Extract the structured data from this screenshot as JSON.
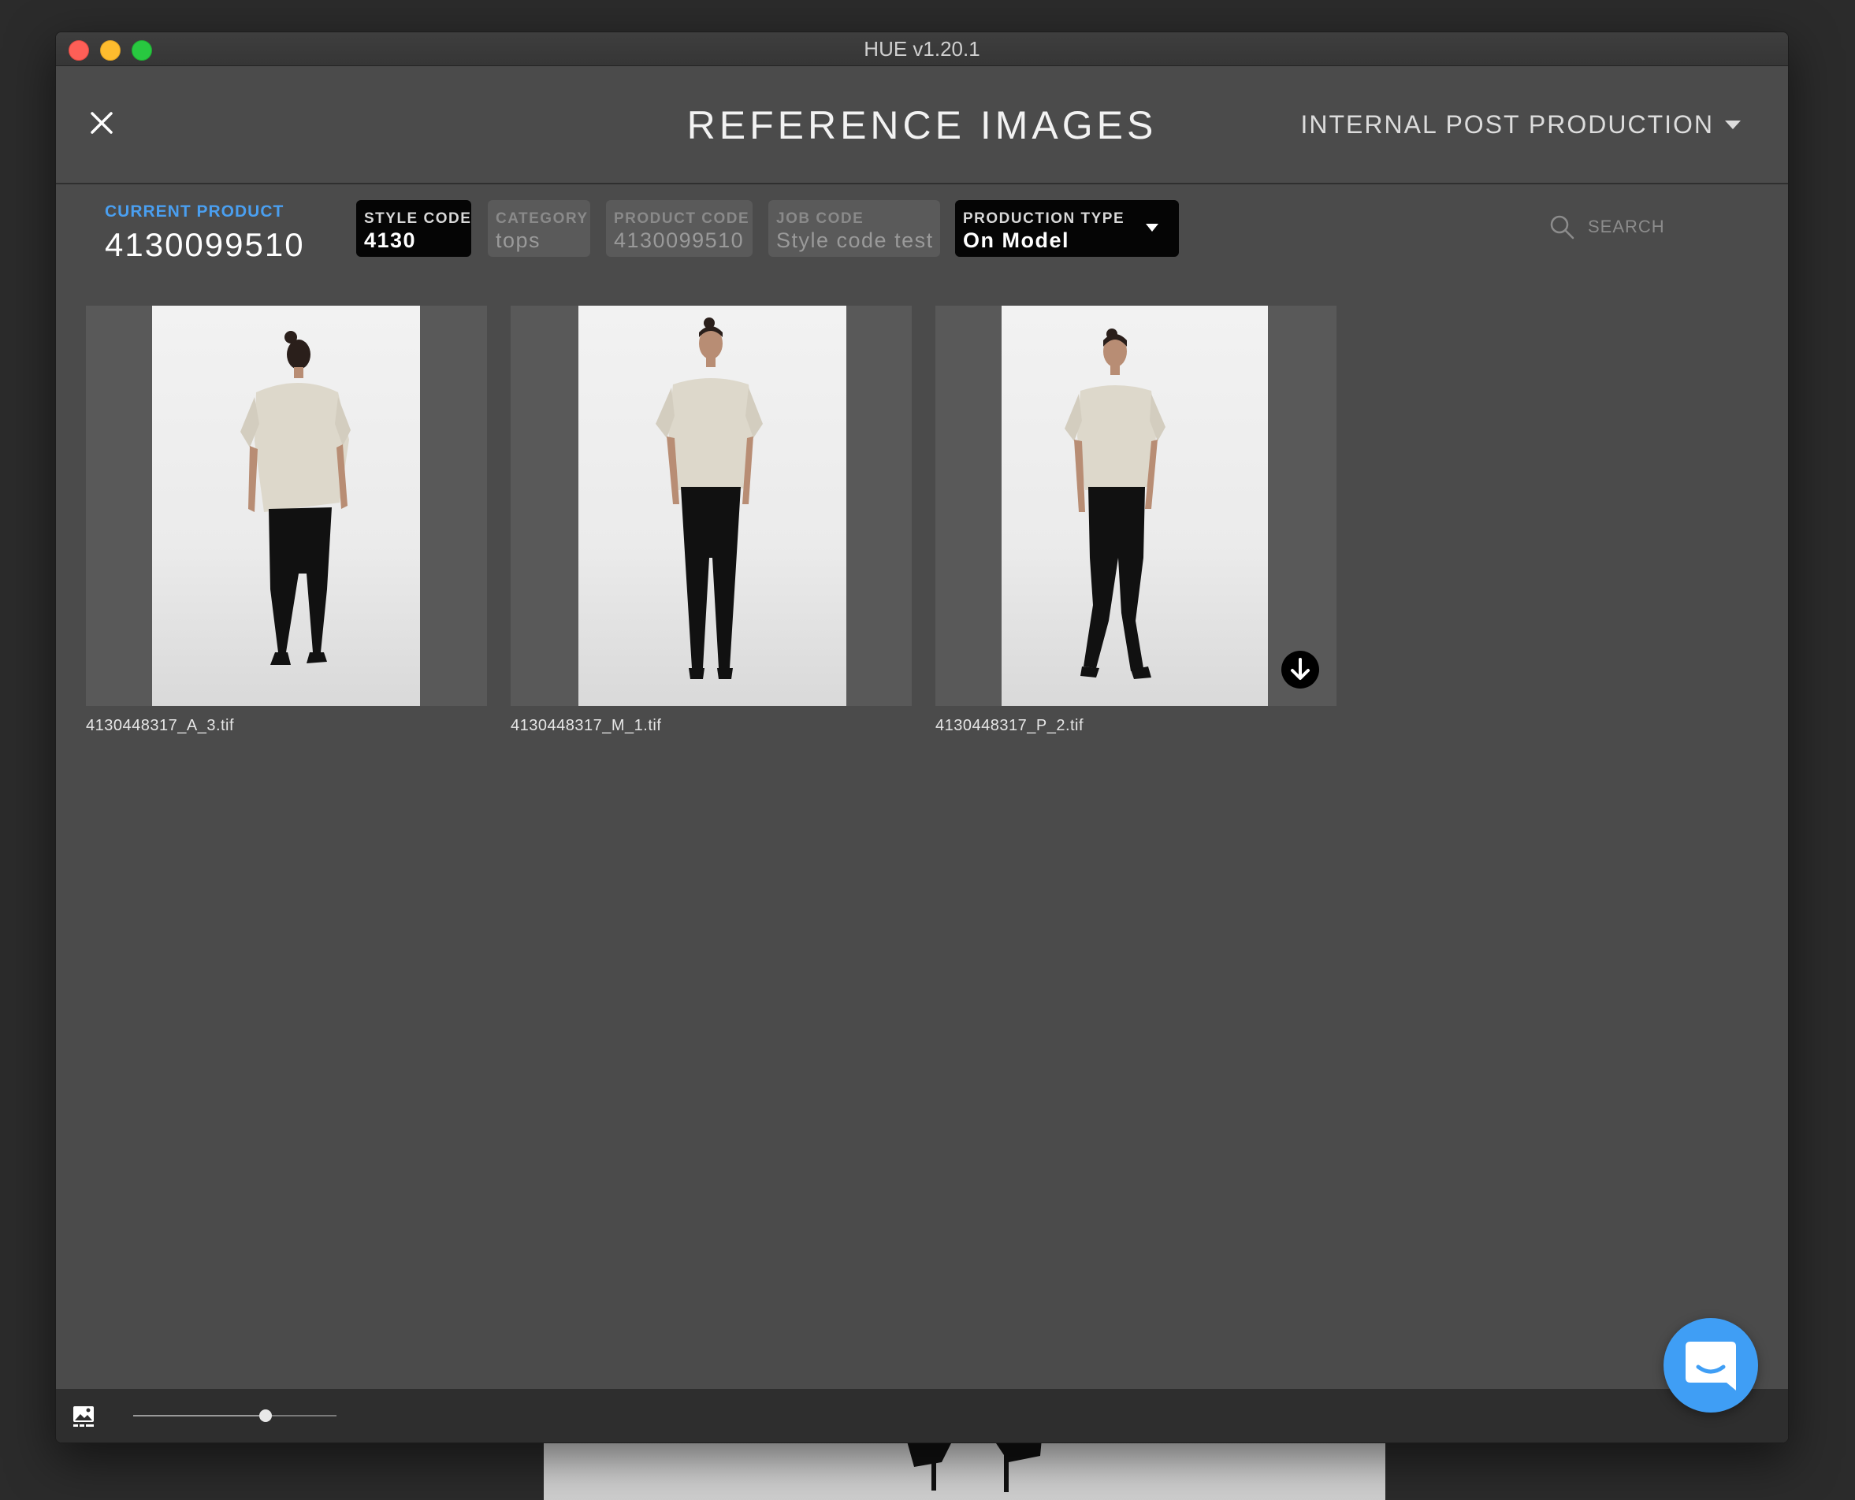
{
  "window": {
    "title": "HUE v1.20.1"
  },
  "header": {
    "page_title": "REFERENCE IMAGES",
    "department": "INTERNAL POST PRODUCTION"
  },
  "current_product": {
    "label": "CURRENT PRODUCT",
    "value": "4130099510"
  },
  "filters": [
    {
      "label": "STYLE CODE",
      "value": "4130"
    },
    {
      "label": "CATEGORY",
      "value": "tops"
    },
    {
      "label": "PRODUCT CODE",
      "value": "4130099510"
    },
    {
      "label": "JOB CODE",
      "value": "Style code test"
    },
    {
      "label": "PRODUCTION TYPE",
      "value": "On Model"
    }
  ],
  "search": {
    "placeholder": "SEARCH"
  },
  "images": [
    {
      "filename": "4130448317_A_3.tif",
      "pose": "back"
    },
    {
      "filename": "4130448317_M_1.tif",
      "pose": "front"
    },
    {
      "filename": "4130448317_P_2.tif",
      "pose": "walking"
    }
  ],
  "footer": {
    "thumbnail_size": 0.65
  },
  "icons": {
    "close": "close-icon",
    "dropdown": "chevron-down-icon",
    "search": "search-icon",
    "download": "download-icon",
    "image_size": "image-icon",
    "chat": "chat-icon"
  },
  "colors": {
    "accent": "#4a9ff0",
    "chat": "#3f9ef5",
    "background": "#4b4b4b"
  }
}
